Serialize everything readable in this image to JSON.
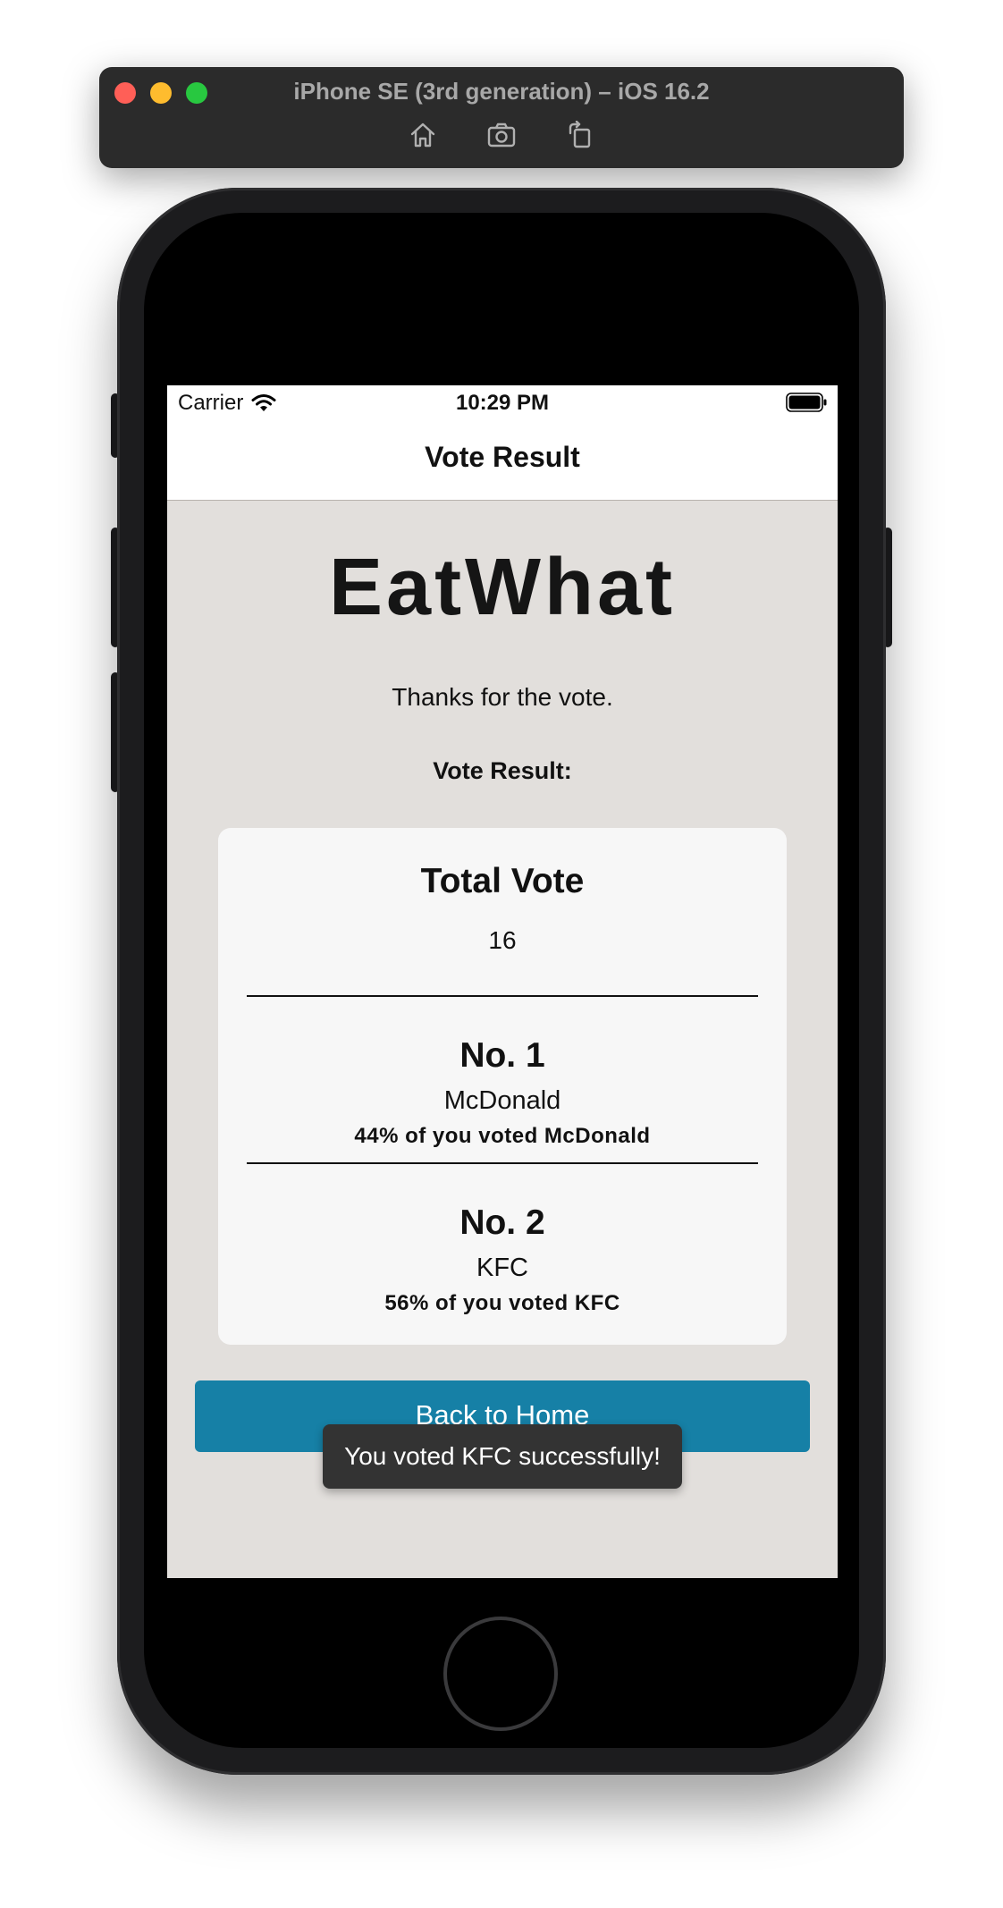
{
  "simulator": {
    "title": "iPhone SE (3rd generation) – iOS 16.2",
    "toolbar": [
      "home-icon",
      "screenshot-icon",
      "rotate-icon"
    ]
  },
  "status_bar": {
    "carrier": "Carrier",
    "time": "10:29 PM"
  },
  "nav": {
    "title": "Vote Result"
  },
  "app": {
    "title": "EatWhat",
    "thanks": "Thanks for the vote.",
    "result_heading": "Vote Result:"
  },
  "result_card": {
    "total_label": "Total Vote",
    "total_value": "16",
    "rankings": [
      {
        "rank": "No. 1",
        "name": "McDonald",
        "percent_text": "44% of you voted McDonald"
      },
      {
        "rank": "No. 2",
        "name": "KFC",
        "percent_text": "56% of you voted KFC"
      }
    ]
  },
  "button": {
    "back_home": "Back to Home"
  },
  "toast": {
    "message": "You voted KFC successfully!"
  },
  "colors": {
    "screen_background": "#e2dfdc",
    "card_background": "#f7f7f7",
    "button_background": "#1680a6",
    "toast_background": "#333333"
  }
}
